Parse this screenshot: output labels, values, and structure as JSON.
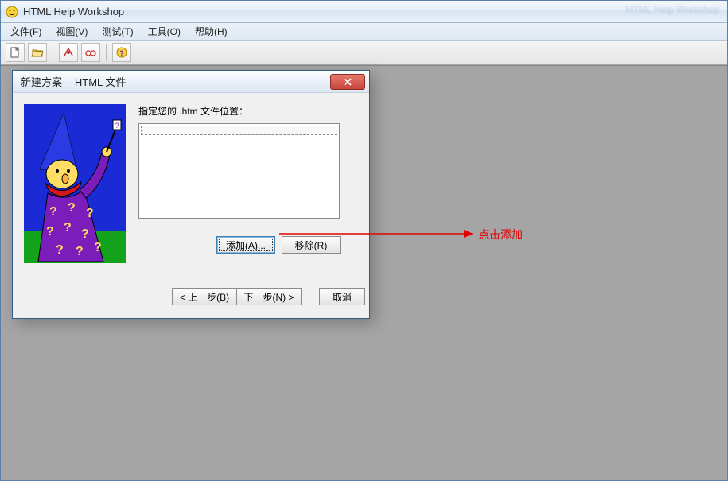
{
  "titlebar": {
    "app_title": "HTML Help Workshop",
    "bg_app_text": "HTML Help Workshop"
  },
  "menubar": {
    "items": [
      "文件(F)",
      "视图(V)",
      "测试(T)",
      "工具(O)",
      "帮助(H)"
    ]
  },
  "toolbar": {
    "icons": [
      "new-file",
      "open-file",
      "compile",
      "preview",
      "help-wizard"
    ]
  },
  "dialog": {
    "title": "新建方案 -- HTML 文件",
    "label": "指定您的 .htm 文件位置：",
    "add_btn": "添加(A)...",
    "remove_btn": "移除(R)",
    "back_btn": "< 上一步(B)",
    "next_btn": "下一步(N) >",
    "cancel_btn": "取消"
  },
  "annotation": {
    "text": "点击添加"
  }
}
